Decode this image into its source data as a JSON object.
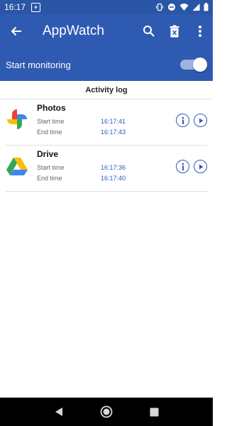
{
  "status_bar": {
    "time": "16:17",
    "left_icon": "notification-icon",
    "right_icons": [
      "vibrate-icon",
      "dnd-icon",
      "wifi-icon",
      "signal-icon",
      "battery-icon"
    ]
  },
  "app_bar": {
    "title": "AppWatch",
    "back_icon": "arrow-back-icon",
    "actions": [
      "search-icon",
      "delete-icon",
      "more-vert-icon"
    ]
  },
  "monitor": {
    "label": "Start monitoring",
    "enabled": true
  },
  "activity_log": {
    "header": "Activity log",
    "items": [
      {
        "app": "Photos",
        "icon": "photos-icon",
        "start_label": "Start time",
        "start_value": "16:17:41",
        "end_label": "End time",
        "end_value": "16:17:43"
      },
      {
        "app": "Drive",
        "icon": "drive-icon",
        "start_label": "Start time",
        "start_value": "16:17:36",
        "end_label": "End time",
        "end_value": "16:17:40"
      }
    ]
  },
  "nav_bar": {
    "buttons": [
      "back-nav-icon",
      "home-nav-icon",
      "recents-nav-icon"
    ]
  },
  "colors": {
    "primary": "#2f5ab1",
    "status_bar": "#2a56a8",
    "time_value": "#2a60b8"
  }
}
